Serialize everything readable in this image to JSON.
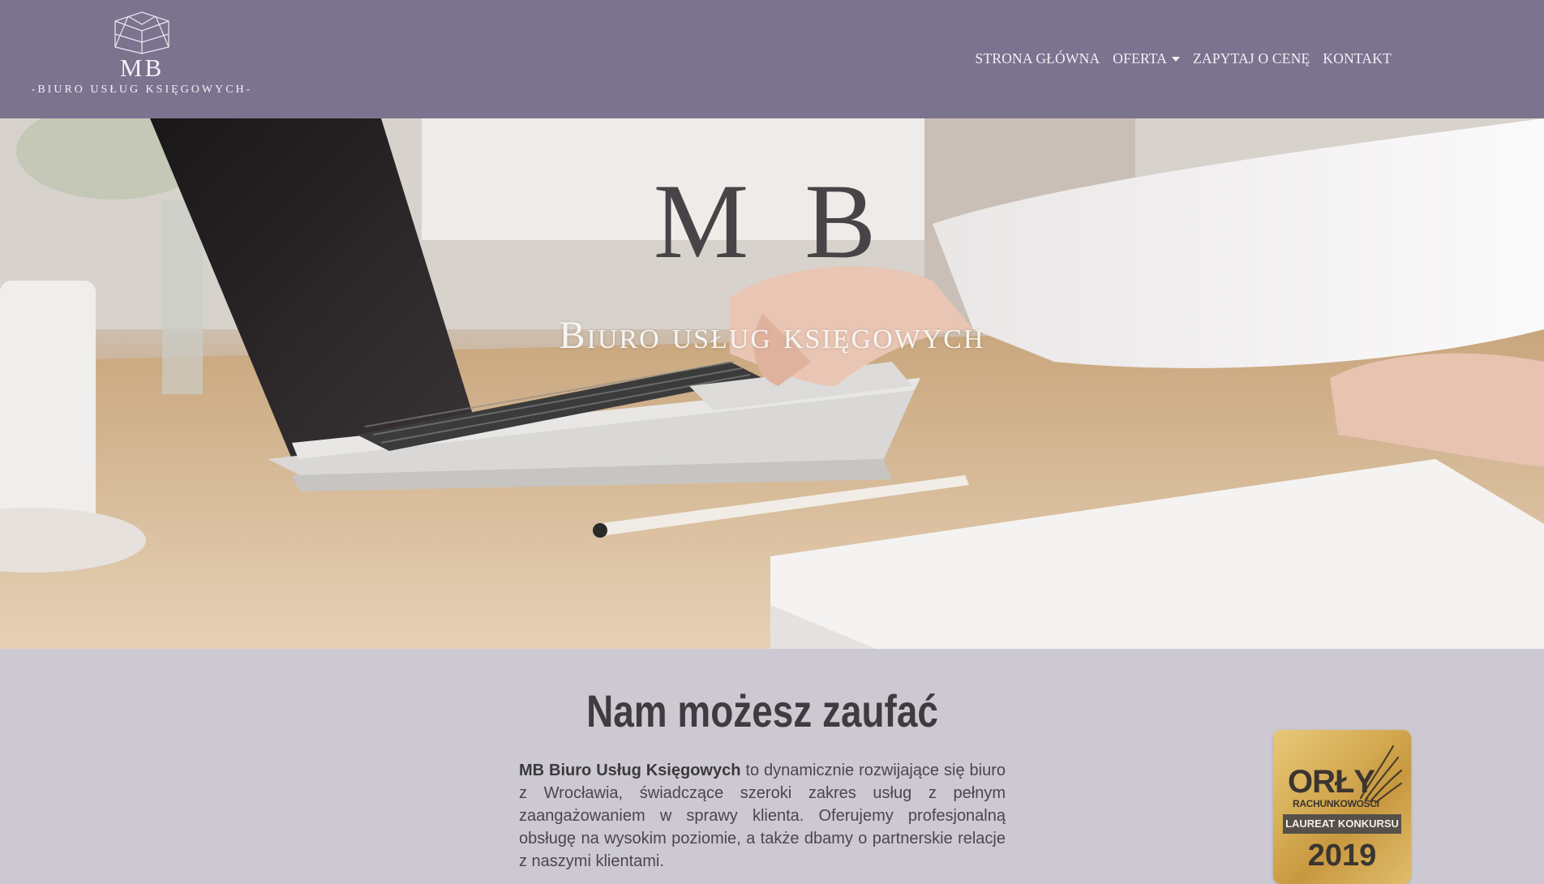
{
  "header": {
    "logo": {
      "mark": "MB",
      "subtitle": "-BIURO USŁUG KSIĘGOWYCH-"
    },
    "nav": [
      {
        "label": "STRONA GŁÓWNA"
      },
      {
        "label": "OFERTA",
        "dropdown": true
      },
      {
        "label": "ZAPYTAJ O CENĘ"
      },
      {
        "label": "KONTAKT"
      }
    ]
  },
  "hero": {
    "title": "M B",
    "subtitle": "Biuro usług księgowych"
  },
  "about": {
    "title": "Nam możesz zaufać",
    "intro_strong": "MB Biuro Usług Księgowych",
    "intro_rest": " to dynamicznie rozwijające się biuro z Wrocławia, świadczące szeroki zakres usług z pełnym zaangażowaniem w sprawy klienta. Oferujemy profesjonalną obsługę na wysokim poziomie, a także dbamy o partnerskie relacje z naszymi klientami."
  },
  "badge": {
    "title": "ORŁY",
    "subtitle": "RACHUNKOWOŚCI",
    "band": "LAUREAT KONKURSU",
    "year": "2019"
  },
  "colors": {
    "header_bg": "#7c738f",
    "page_bg": "#cdc9d2",
    "text_dark": "#3f3c40"
  }
}
